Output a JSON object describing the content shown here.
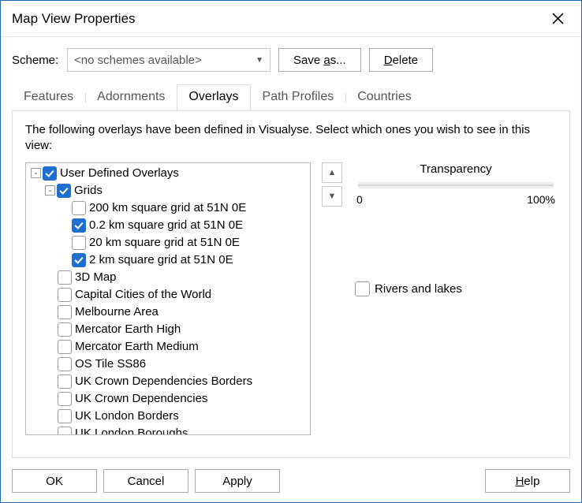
{
  "title": "Map View Properties",
  "scheme": {
    "label": "Scheme:",
    "value": "<no schemes available>",
    "save_as_label": "Save as...",
    "delete_label": "Delete"
  },
  "tabs": [
    {
      "label": "Features",
      "active": false
    },
    {
      "label": "Adornments",
      "active": false
    },
    {
      "label": "Overlays",
      "active": true
    },
    {
      "label": "Path Profiles",
      "active": false
    },
    {
      "label": "Countries",
      "active": false
    }
  ],
  "description": "The following overlays have been defined in Visualyse. Select which ones you wish to see in this view:",
  "tree": [
    {
      "level": 0,
      "expander": "-",
      "checked": true,
      "label": "User Defined Overlays"
    },
    {
      "level": 1,
      "expander": "-",
      "checked": true,
      "label": "Grids"
    },
    {
      "level": 2,
      "expander": "",
      "checked": false,
      "label": "200 km square grid at 51N 0E"
    },
    {
      "level": 2,
      "expander": "",
      "checked": true,
      "label": "0.2 km square grid at 51N 0E"
    },
    {
      "level": 2,
      "expander": "",
      "checked": false,
      "label": "20 km square grid at 51N 0E"
    },
    {
      "level": 2,
      "expander": "",
      "checked": true,
      "label": "2 km square grid at 51N 0E"
    },
    {
      "level": 2,
      "expander": "",
      "checked": false,
      "label": "3D Map",
      "sibling": true
    },
    {
      "level": 2,
      "expander": "",
      "checked": false,
      "label": "Capital Cities of the World",
      "sibling": true
    },
    {
      "level": 2,
      "expander": "",
      "checked": false,
      "label": "Melbourne Area",
      "sibling": true
    },
    {
      "level": 2,
      "expander": "",
      "checked": false,
      "label": "Mercator Earth High",
      "sibling": true
    },
    {
      "level": 2,
      "expander": "",
      "checked": false,
      "label": "Mercator Earth Medium",
      "sibling": true
    },
    {
      "level": 2,
      "expander": "",
      "checked": false,
      "label": "OS Tile SS86",
      "sibling": true
    },
    {
      "level": 2,
      "expander": "",
      "checked": false,
      "label": "UK Crown Dependencies Borders",
      "sibling": true
    },
    {
      "level": 2,
      "expander": "",
      "checked": false,
      "label": "UK Crown Dependencies",
      "sibling": true
    },
    {
      "level": 2,
      "expander": "",
      "checked": false,
      "label": "UK London Borders",
      "sibling": true
    },
    {
      "level": 2,
      "expander": "",
      "checked": false,
      "label": "UK London Boroughs",
      "sibling": true
    }
  ],
  "transparency": {
    "label": "Transparency",
    "min_label": "0",
    "max_label": "100%"
  },
  "rivers": {
    "checked": false,
    "label": "Rivers and lakes"
  },
  "footer": {
    "ok": "OK",
    "cancel": "Cancel",
    "apply": "Apply",
    "help": "Help"
  }
}
